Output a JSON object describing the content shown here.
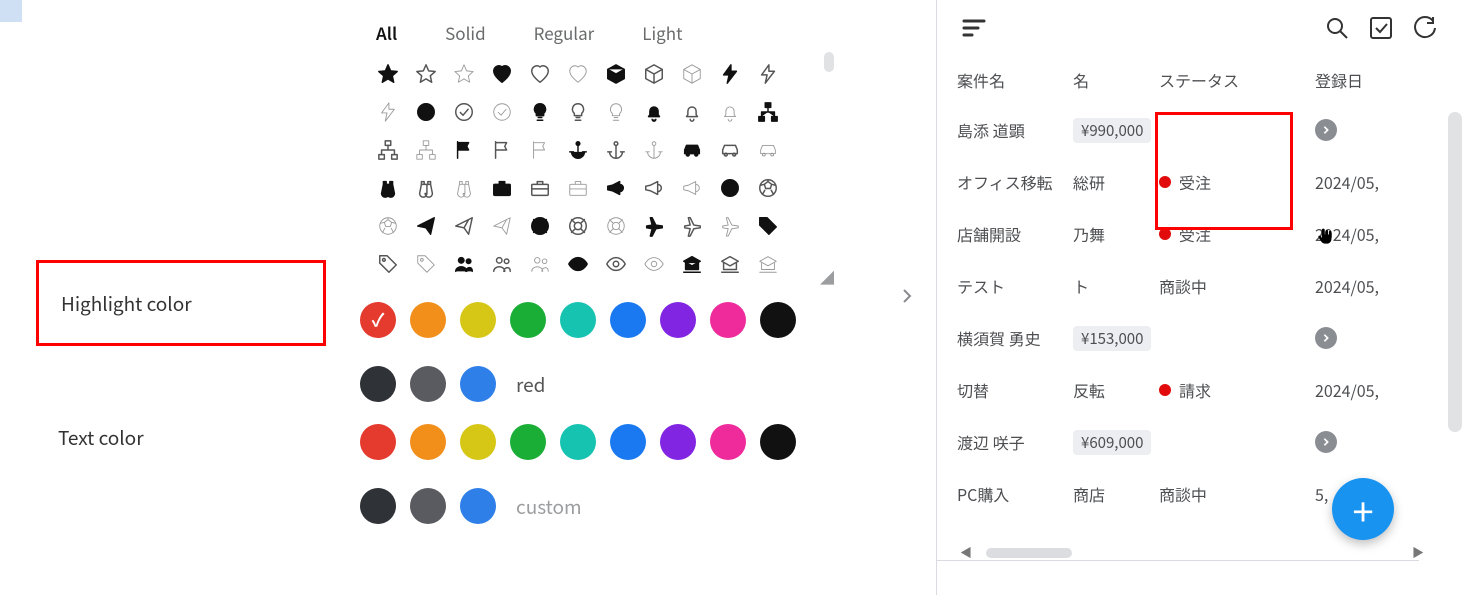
{
  "left": {
    "tabs": [
      "All",
      "Solid",
      "Regular",
      "Light"
    ],
    "selected_tab_index": 0,
    "labels": {
      "highlight": "Highlight color",
      "text_color": "Text color"
    },
    "highlight_colors": {
      "swatches": [
        "#e53a2e",
        "#f28f1a",
        "#d6c717",
        "#1aae37",
        "#16c3b1",
        "#1a79f0",
        "#8125e2",
        "#ef2b9c",
        "#111111",
        "#2f3237",
        "#595b60",
        "#2f7fe8"
      ],
      "selected_index": 0,
      "selected_label": "red"
    },
    "text_colors": {
      "swatches": [
        "#e53a2e",
        "#f28f1a",
        "#d6c717",
        "#1aae37",
        "#16c3b1",
        "#1a79f0",
        "#8125e2",
        "#ef2b9c",
        "#111111",
        "#2f3237",
        "#595b60",
        "#2f7fe8"
      ],
      "caption": "custom"
    },
    "icons": [
      "star-solid",
      "star-outline",
      "star-light",
      "heart-solid",
      "heart-outline",
      "heart-light",
      "cube-solid",
      "cube-outline",
      "cube-light",
      "bolt-solid",
      "bolt-outline",
      "bolt-light",
      "check-circle-solid",
      "check-circle-outline",
      "check-circle-light",
      "lightbulb-solid",
      "lightbulb-outline",
      "lightbulb-light",
      "bell-solid",
      "bell-outline",
      "bell-light",
      "sitemap-solid",
      "sitemap-outline",
      "sitemap-light",
      "flag-solid",
      "flag-outline",
      "flag-light",
      "anchor-solid",
      "anchor-outline",
      "anchor-light",
      "car-solid",
      "car-outline",
      "car-light",
      "binoculars-solid",
      "binoculars-outline",
      "binoculars-light",
      "briefcase-solid",
      "briefcase-outline",
      "briefcase-light",
      "bullhorn-solid",
      "bullhorn-outline",
      "bullhorn-light",
      "futbol-solid",
      "futbol-outline",
      "futbol-light",
      "paper-plane-solid",
      "paper-plane-outline",
      "paper-plane-light",
      "life-ring-solid",
      "life-ring-outline",
      "life-ring-light",
      "plane-solid",
      "plane-outline",
      "plane-light",
      "tag-solid",
      "tag-outline",
      "tag-light",
      "users-solid",
      "users-outline",
      "users-light",
      "eye-solid",
      "eye-outline",
      "eye-light",
      "university-solid",
      "university-outline",
      "university-light"
    ]
  },
  "right": {
    "headers": {
      "name": "案件名",
      "person": "名",
      "status": "ステータス",
      "date": "登録日"
    },
    "rows": [
      {
        "name": "島添 道顕",
        "col2_type": "money",
        "col2": "¥990,000",
        "status_type": "chevron"
      },
      {
        "name": "オフィス移転",
        "col2_type": "text",
        "col2": "総研",
        "status_type": "dot",
        "status": "受注",
        "date": "2024/05,"
      },
      {
        "name": "店舗開設",
        "col2_type": "text",
        "col2": "乃舞",
        "status_type": "dot",
        "status": "受注",
        "date": "2024/05,"
      },
      {
        "name": "テスト",
        "col2_type": "text",
        "col2": "ト",
        "status_type": "plain",
        "status": "商談中",
        "date": "2024/05,"
      },
      {
        "name": "横須賀 勇史",
        "col2_type": "money",
        "col2": "¥153,000",
        "status_type": "chevron"
      },
      {
        "name": "切替",
        "col2_type": "text",
        "col2": "反転",
        "status_type": "dot",
        "status": "請求",
        "date": "2024/05,"
      },
      {
        "name": "渡辺 咲子",
        "col2_type": "money",
        "col2": "¥609,000",
        "status_type": "chevron"
      },
      {
        "name": "PC購入",
        "col2_type": "text",
        "col2": "商店",
        "status_type": "plain",
        "status": "商談中",
        "date": "5,"
      }
    ]
  }
}
